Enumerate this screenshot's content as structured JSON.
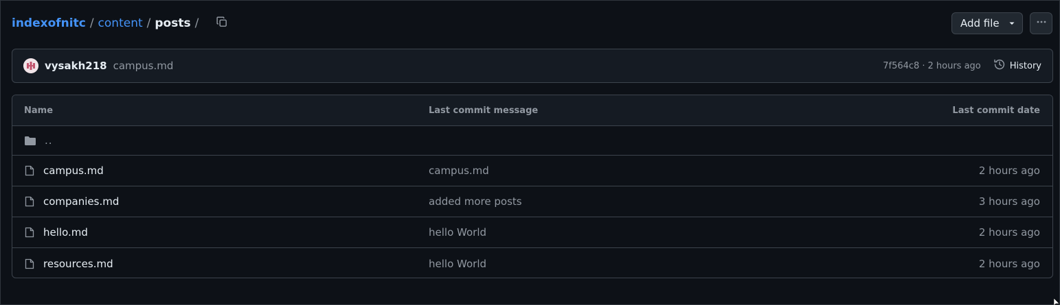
{
  "breadcrumb": {
    "repo": "indexofnitc",
    "folder": "content",
    "current": "posts",
    "separator": "/"
  },
  "actions": {
    "add_file_label": "Add file",
    "more_icon": "kebab-horizontal-icon"
  },
  "commit": {
    "author": "vysakh218",
    "message": "campus.md",
    "sha": "7f564c8",
    "dot": "·",
    "time": "2 hours ago",
    "history_label": "History"
  },
  "table": {
    "headers": {
      "name": "Name",
      "message": "Last commit message",
      "date": "Last commit date"
    },
    "parent_label": "..",
    "rows": [
      {
        "name": "campus.md",
        "message": "campus.md",
        "date": "2 hours ago"
      },
      {
        "name": "companies.md",
        "message": "added more posts",
        "date": "3 hours ago"
      },
      {
        "name": "hello.md",
        "message": "hello World",
        "date": "2 hours ago"
      },
      {
        "name": "resources.md",
        "message": "hello World",
        "date": "2 hours ago"
      }
    ]
  },
  "colors": {
    "background": "#0d1117",
    "link": "#4493f8",
    "muted": "#9198a1",
    "border": "#3d444d",
    "surface": "#151b23"
  }
}
